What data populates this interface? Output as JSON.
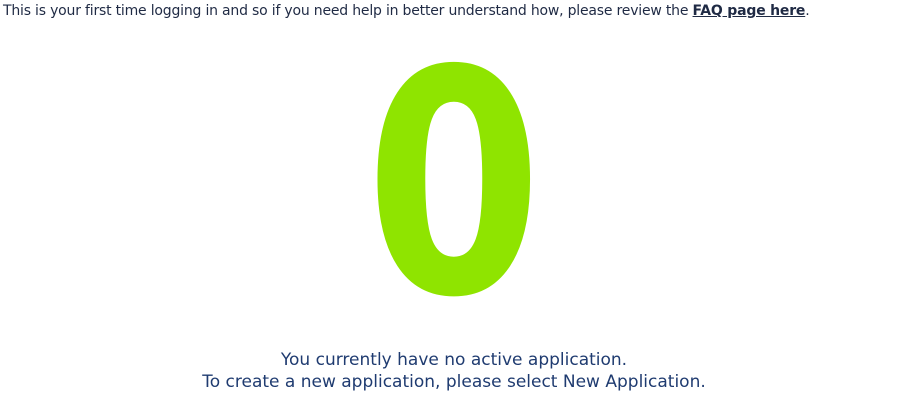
{
  "intro": {
    "text": "This is your first time logging in and so if you need help in better understand how, please review the ",
    "link_label": "FAQ page here",
    "suffix": "."
  },
  "applications": {
    "count": "0",
    "count_color": "#8fe400"
  },
  "message": {
    "line1": "You currently have no active application.",
    "line2": "To create a new application, please select New Application."
  },
  "colors": {
    "text": "#1f2a44",
    "message_text": "#1f3b70",
    "background": "#ffffff"
  }
}
